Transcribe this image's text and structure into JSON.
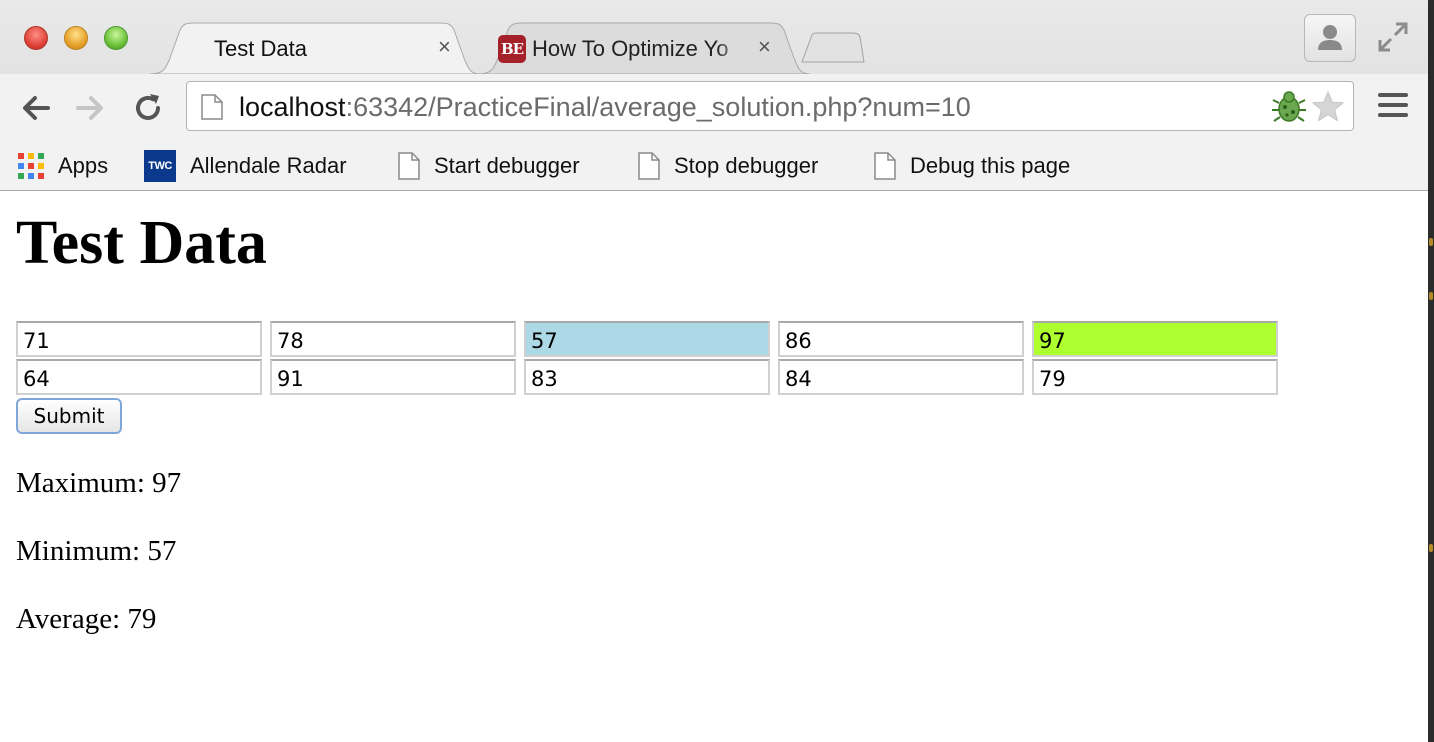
{
  "browser": {
    "tabs": [
      {
        "title": "Test Data",
        "active": true,
        "close": "×"
      },
      {
        "title": "How To Optimize Yo",
        "active": false,
        "close": "×",
        "favicon_text": "BE"
      }
    ],
    "url": {
      "host": "localhost",
      "rest": ":63342/PracticeFinal/average_solution.php?num=10"
    },
    "bookmarks": [
      {
        "label": "Apps",
        "icon": "apps-grid-icon"
      },
      {
        "label": "Allendale Radar",
        "icon": "twc-logo-icon",
        "icon_text": "TWC"
      },
      {
        "label": "Start debugger",
        "icon": "page-icon"
      },
      {
        "label": "Stop debugger",
        "icon": "page-icon"
      },
      {
        "label": "Debug this page",
        "icon": "page-icon"
      }
    ]
  },
  "page": {
    "heading": "Test Data",
    "inputs_row1": [
      "71",
      "78",
      "57",
      "86",
      "97"
    ],
    "inputs_row2": [
      "64",
      "91",
      "83",
      "84",
      "79"
    ],
    "highlight_colors": {
      "minimum": "#add8e6",
      "maximum": "#adff2f"
    },
    "submit_label": "Submit",
    "stats": {
      "maximum": "Maximum: 97",
      "minimum": "Minimum: 57",
      "average": "Average: 79"
    }
  }
}
